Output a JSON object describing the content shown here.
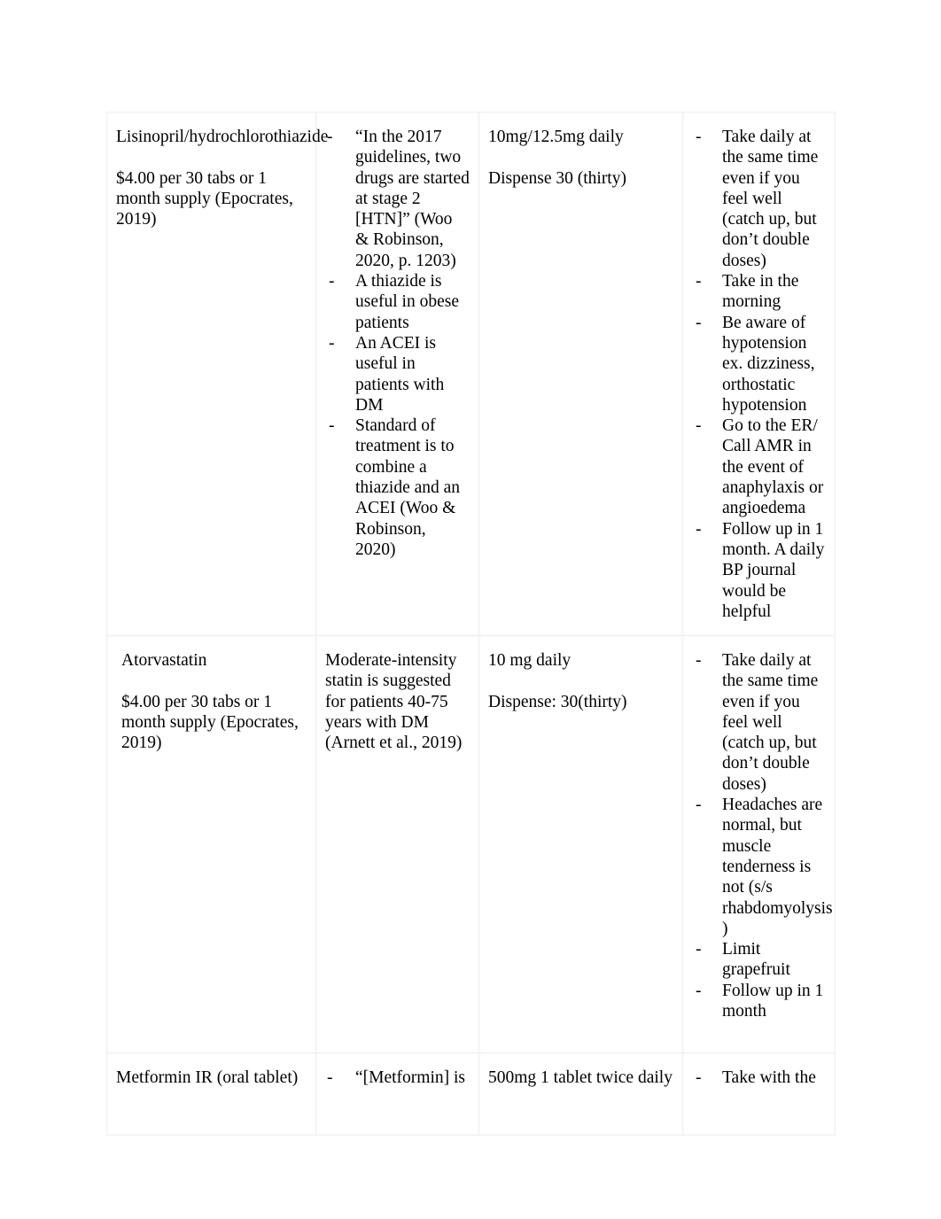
{
  "document": {
    "type": "medication-plan-table",
    "columns": [
      "drug-and-cost",
      "rationale",
      "dosing-and-dispense",
      "patient-education"
    ]
  },
  "rows": [
    {
      "drug": {
        "name": "Lisinopril/hydrochlorothiazide",
        "cost": "$4.00 per 30 tabs or 1 month supply (Epocrates, 2019)"
      },
      "rationale": [
        "“In the 2017 guidelines, two drugs are started at stage 2 [HTN]” (Woo & Robinson, 2020, p. 1203)",
        "A thiazide is useful in obese patients",
        "An ACEI is useful in patients with DM",
        "Standard of treatment is to combine a thiazide and an ACEI (Woo & Robinson, 2020)"
      ],
      "dosing": {
        "dose": "10mg/12.5mg daily",
        "dispense": "Dispense 30 (thirty)"
      },
      "education": [
        "Take daily at the same time even if you feel well (catch up, but don’t double doses)",
        "Take in the morning",
        "Be aware of hypotension ex. dizziness, orthostatic hypotension",
        "Go to the ER/ Call AMR in the event of anaphylaxis or angioedema",
        "Follow up in 1 month. A daily BP journal would be helpful"
      ]
    },
    {
      "drug": {
        "name": "Atorvastatin",
        "cost": "$4.00 per 30 tabs or 1 month supply (Epocrates, 2019)"
      },
      "rationale_paragraph": "Moderate-intensity statin is suggested for patients 40-75 years with DM (Arnett et al., 2019)",
      "dosing": {
        "dose": "10 mg daily",
        "dispense": "Dispense: 30(thirty)"
      },
      "education": [
        "Take daily at the same time even if you feel well (catch up, but don’t double doses)",
        "Headaches are normal, but muscle tenderness is not (s/s rhabdomyolysis )",
        "Limit grapefruit",
        "Follow up in 1 month"
      ]
    },
    {
      "drug": {
        "name": "Metformin IR (oral tablet)"
      },
      "rationale": [
        "“[Metformin] is"
      ],
      "dosing": {
        "dose": "500mg 1 tablet twice daily"
      },
      "education": [
        "Take with the"
      ]
    }
  ]
}
